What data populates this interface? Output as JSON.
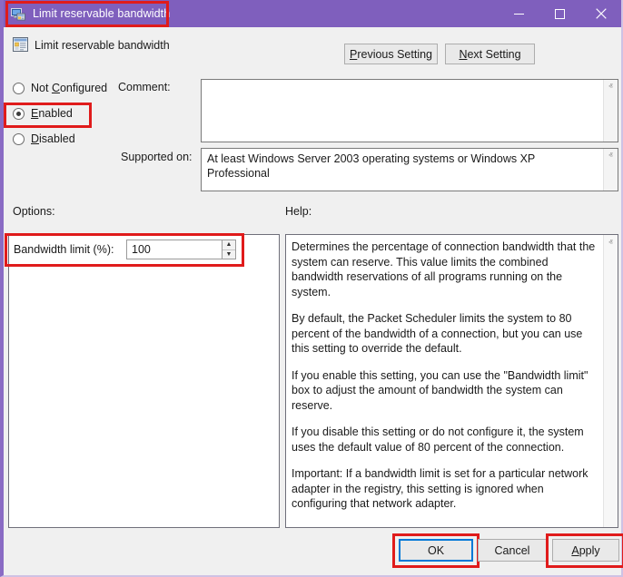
{
  "window": {
    "title": "Limit reservable bandwidth",
    "title_icon": "computer-policy-icon",
    "titlebar_color": "#7f5fbd",
    "minimize_label": "Minimize",
    "maximize_label": "Maximize",
    "close_label": "Close"
  },
  "header": {
    "icon": "policy-setting-icon",
    "setting_name": "Limit reservable bandwidth",
    "previous_setting": "Previous Setting",
    "previous_accel": "P",
    "next_setting": "Next Setting",
    "next_accel": "N"
  },
  "state": {
    "options": [
      {
        "label": "Not Configured",
        "accel": "C",
        "pre": "Not ",
        "post": "onfigured",
        "selected": false
      },
      {
        "label": "Enabled",
        "accel": "E",
        "pre": "",
        "post": "nabled",
        "selected": true
      },
      {
        "label": "Disabled",
        "accel": "D",
        "pre": "",
        "post": "isabled",
        "selected": false
      }
    ]
  },
  "comment": {
    "label": "Comment:",
    "value": "",
    "placeholder": ""
  },
  "supported": {
    "label": "Supported on:",
    "value": "At least Windows Server 2003 operating systems or Windows XP Professional"
  },
  "options_section": {
    "label": "Options:",
    "bandwidth_label": "Bandwidth limit (%):",
    "bandwidth_value": "100",
    "spinner_up": "▲",
    "spinner_down": "▼"
  },
  "help_section": {
    "label": "Help:",
    "paragraphs": [
      "Determines the percentage of connection bandwidth that the system can reserve. This value limits the combined bandwidth reservations of all programs running on the system.",
      "By default, the Packet Scheduler limits the system to 80 percent of the bandwidth of a connection, but you can use this setting to override the default.",
      "If you enable this setting, you can use the \"Bandwidth limit\" box to adjust the amount of bandwidth the system can reserve.",
      "If you disable this setting or do not configure it, the system uses the default value of 80 percent of the connection.",
      "Important: If a bandwidth limit is set for a particular network adapter in the registry, this setting is ignored when configuring that network adapter."
    ]
  },
  "footer": {
    "ok_label": "OK",
    "cancel_label": "Cancel",
    "apply_label": "Apply",
    "apply_accel": "A"
  },
  "annotations": {
    "highlight_color": "#e01b1b",
    "focus_color": "#0078d7",
    "boxes": [
      "title-highlight",
      "enabled-highlight",
      "bandwidth-row-highlight",
      "ok-highlight",
      "apply-highlight"
    ]
  },
  "scroll": {
    "up_arrow": "ⱏ",
    "down_arrow": "ⱟ"
  }
}
